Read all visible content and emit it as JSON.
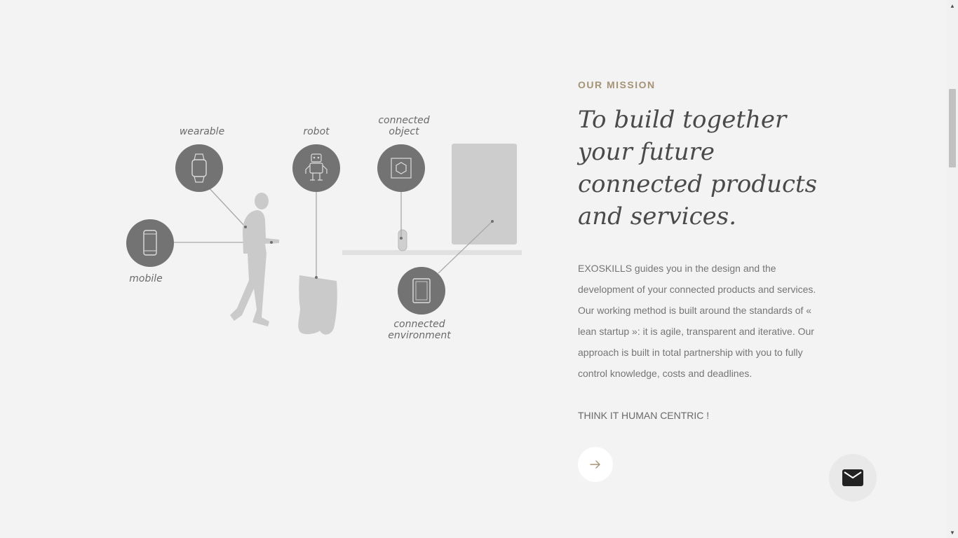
{
  "illustration": {
    "labels": {
      "wearable": "wearable",
      "robot": "robot",
      "connected_object": "connected object",
      "mobile": "mobile",
      "connected_environment": "connected environment"
    },
    "icons": [
      "smartphone-icon",
      "smartwatch-icon",
      "robot-icon",
      "hexagon-object-icon",
      "tablet-icon"
    ]
  },
  "mission": {
    "eyebrow": "OUR MISSION",
    "headline": "To build together your future connected products and services.",
    "body": "EXOSKILLS guides you in the design and the development of your connected products and services. Our working method is built around the standards of « lean startup »: it is agile, transparent and iterative. Our approach is built in total partnership with you to fully control knowledge, costs and deadlines.",
    "tagline": "THINK IT HUMAN CENTRIC !",
    "arrow_icon": "arrow-right-icon"
  },
  "contact": {
    "icon": "mail-icon"
  },
  "colors": {
    "background": "#f3f3f3",
    "accent": "#a59376",
    "circle": "#737373",
    "silhouette": "#cccccc"
  }
}
